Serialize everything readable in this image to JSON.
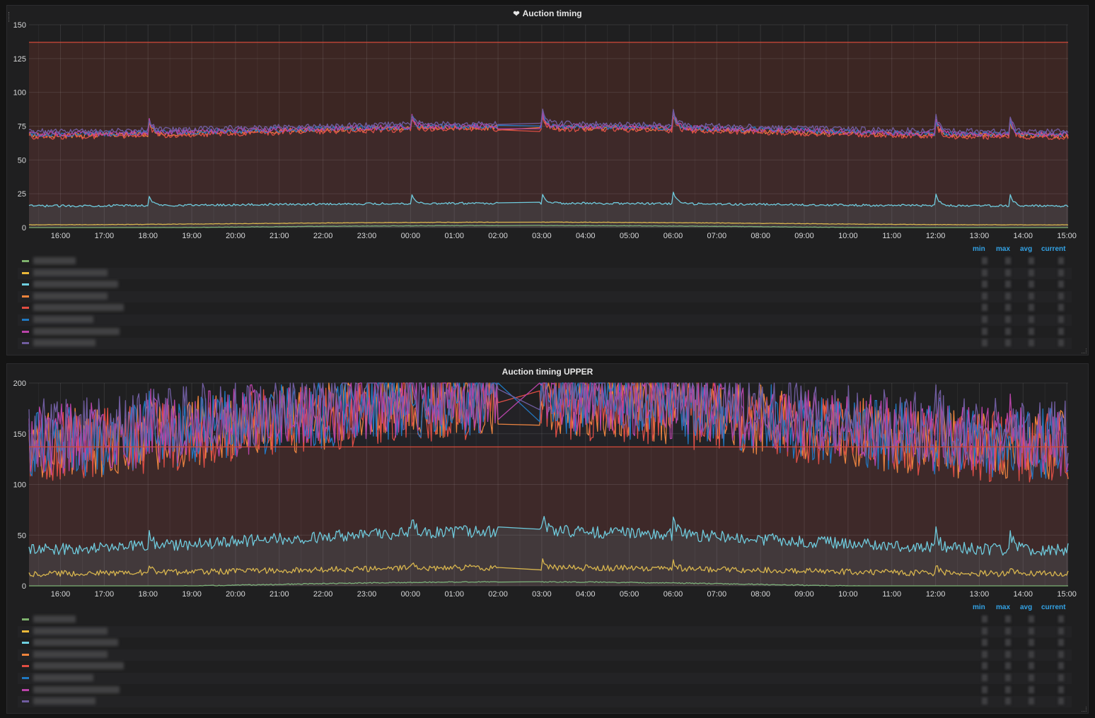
{
  "chart_data": [
    {
      "type": "line",
      "title": "Auction timing",
      "title_icon": "heart-icon",
      "x_ticks": [
        "16:00",
        "17:00",
        "18:00",
        "19:00",
        "20:00",
        "21:00",
        "22:00",
        "23:00",
        "00:00",
        "01:00",
        "02:00",
        "03:00",
        "04:00",
        "05:00",
        "06:00",
        "07:00",
        "08:00",
        "09:00",
        "10:00",
        "11:00",
        "12:00",
        "13:00",
        "14:00",
        "15:00"
      ],
      "y_ticks": [
        0,
        25,
        50,
        75,
        100,
        125,
        150
      ],
      "ylim": [
        0,
        150
      ],
      "threshold": 137,
      "threshold_color": "#d44a3a",
      "legend_columns": [
        "min",
        "max",
        "avg",
        "current"
      ],
      "legend_placement": "bottom",
      "series": [
        {
          "color": "#7eb26d",
          "level": 0.5
        },
        {
          "color": "#eab839",
          "level": 3
        },
        {
          "color": "#6ed0e0",
          "level": 17
        },
        {
          "color": "#ef843c",
          "level": 71
        },
        {
          "color": "#e24d42",
          "level": 70
        },
        {
          "color": "#1f78c1",
          "level": 72
        },
        {
          "color": "#ba43a9",
          "level": 72
        },
        {
          "color": "#705da0",
          "level": 74
        }
      ]
    },
    {
      "type": "line",
      "title": "Auction timing UPPER",
      "x_ticks": [
        "16:00",
        "17:00",
        "18:00",
        "19:00",
        "20:00",
        "21:00",
        "22:00",
        "23:00",
        "00:00",
        "01:00",
        "02:00",
        "03:00",
        "04:00",
        "05:00",
        "06:00",
        "07:00",
        "08:00",
        "09:00",
        "10:00",
        "11:00",
        "12:00",
        "13:00",
        "14:00",
        "15:00"
      ],
      "y_ticks": [
        0,
        50,
        100,
        150,
        200
      ],
      "ylim": [
        0,
        200
      ],
      "threshold": 137,
      "threshold_color": "#d44a3a",
      "legend_columns": [
        "min",
        "max",
        "avg",
        "current"
      ],
      "legend_placement": "bottom",
      "series": [
        {
          "color": "#7eb26d",
          "level": 1
        },
        {
          "color": "#eab839",
          "level": 15
        },
        {
          "color": "#6ed0e0",
          "level": 45
        },
        {
          "color": "#ef843c",
          "level": 160
        },
        {
          "color": "#e24d42",
          "level": 158
        },
        {
          "color": "#1f78c1",
          "level": 162
        },
        {
          "color": "#ba43a9",
          "level": 165
        },
        {
          "color": "#705da0",
          "level": 172
        }
      ]
    }
  ]
}
